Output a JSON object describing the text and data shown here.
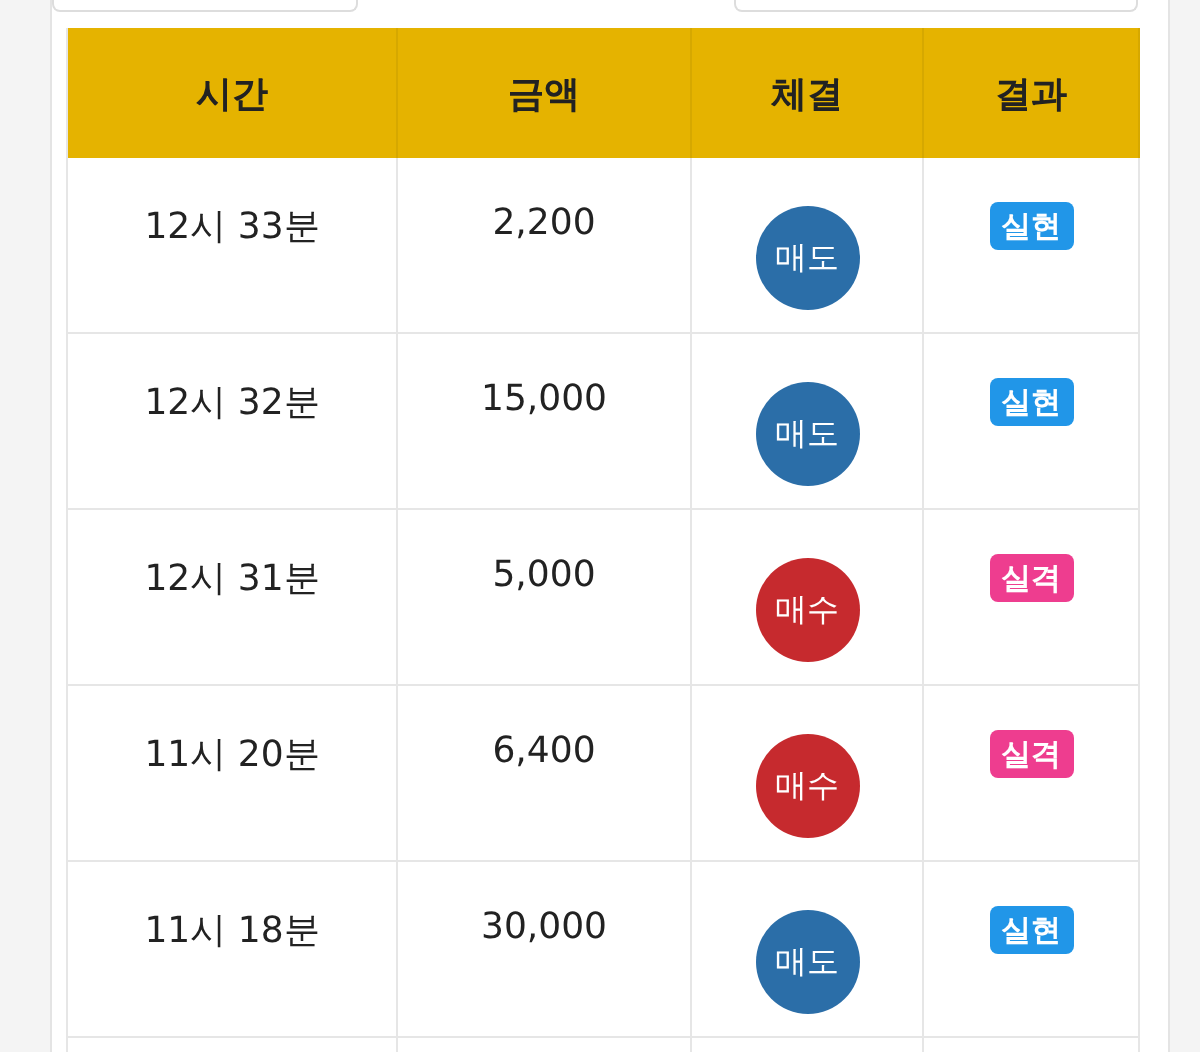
{
  "table": {
    "columns": [
      "시간",
      "금액",
      "체결",
      "결과"
    ],
    "rows": [
      {
        "time": "12시 33분",
        "amount": "2,200",
        "trade": {
          "label": "매도",
          "color": "#2b6ea8"
        },
        "result": {
          "label": "실현",
          "color": "#2196e8"
        }
      },
      {
        "time": "12시 32분",
        "amount": "15,000",
        "trade": {
          "label": "매도",
          "color": "#2b6ea8"
        },
        "result": {
          "label": "실현",
          "color": "#2196e8"
        }
      },
      {
        "time": "12시 31분",
        "amount": "5,000",
        "trade": {
          "label": "매수",
          "color": "#c62a2e"
        },
        "result": {
          "label": "실격",
          "color": "#ee3d8f"
        }
      },
      {
        "time": "11시 20분",
        "amount": "6,400",
        "trade": {
          "label": "매수",
          "color": "#c62a2e"
        },
        "result": {
          "label": "실격",
          "color": "#ee3d8f"
        }
      },
      {
        "time": "11시 18분",
        "amount": "30,000",
        "trade": {
          "label": "매도",
          "color": "#2b6ea8"
        },
        "result": {
          "label": "실현",
          "color": "#2196e8"
        }
      }
    ]
  }
}
